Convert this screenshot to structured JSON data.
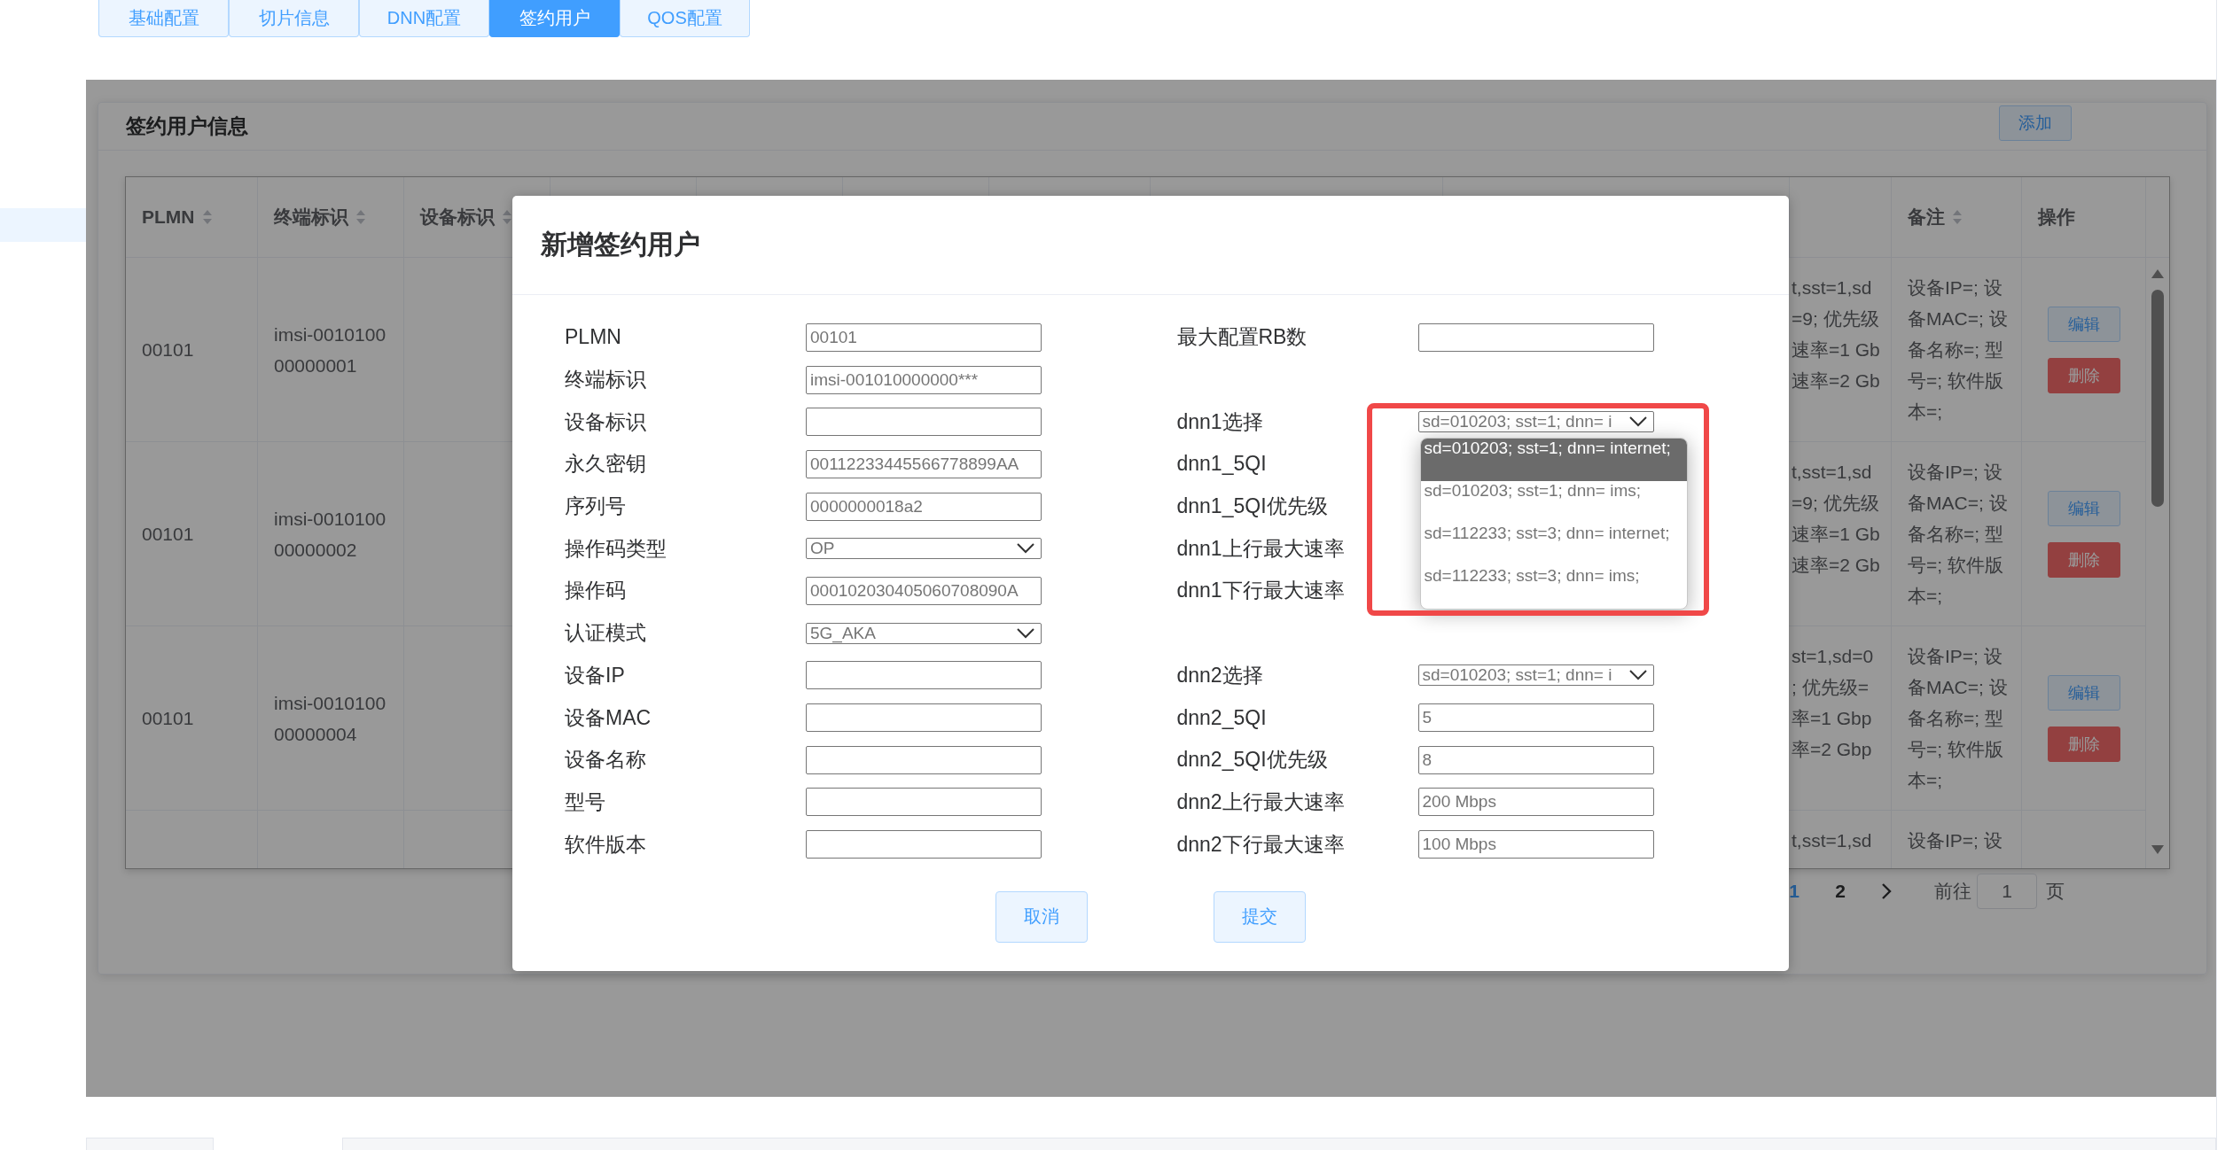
{
  "tabs": [
    {
      "label": "基础配置",
      "selected": false
    },
    {
      "label": "切片信息",
      "selected": false
    },
    {
      "label": "DNN配置",
      "selected": false
    },
    {
      "label": "签约用户",
      "selected": true
    },
    {
      "label": "QOS配置",
      "selected": false
    }
  ],
  "panel": {
    "title": "签约用户信息",
    "add_button": "添加"
  },
  "table": {
    "columns": [
      {
        "label": "PLMN",
        "sortable": true
      },
      {
        "label": "终端标识",
        "sortable": true
      },
      {
        "label": "设备标识",
        "sortable": true
      },
      {
        "label": "备注",
        "sortable": true
      },
      {
        "label": "操作",
        "sortable": false
      }
    ],
    "rows": [
      {
        "plmn": "00101",
        "imsi": [
          "imsi-0010100",
          "00000001"
        ],
        "column_4": [
          "t,sst=1,sd",
          "=9; 优先级",
          "速率=1 Gb",
          "速率=2 Gb"
        ],
        "remark": [
          "设备IP=; 设",
          "备MAC=; 设",
          "备名称=; 型",
          "号=; 软件版",
          "本=;"
        ],
        "actions": [
          {
            "label": "编辑",
            "kind": "edit"
          },
          {
            "label": "删除",
            "kind": "delete"
          }
        ]
      },
      {
        "plmn": "00101",
        "imsi": [
          "imsi-0010100",
          "00000002"
        ],
        "column_4": [
          "t,sst=1,sd",
          "=9; 优先级",
          "速率=1 Gb",
          "速率=2 Gb"
        ],
        "remark": [
          "设备IP=; 设",
          "备MAC=; 设",
          "备名称=; 型",
          "号=; 软件版",
          "本=;"
        ],
        "actions": [
          {
            "label": "编辑",
            "kind": "edit"
          },
          {
            "label": "删除",
            "kind": "delete"
          }
        ]
      },
      {
        "plmn": "00101",
        "imsi": [
          "imsi-0010100",
          "00000004"
        ],
        "column_4": [
          "st=1,sd=0",
          "; 优先级=",
          "率=1 Gbp",
          "率=2 Gbp"
        ],
        "remark": [
          "设备IP=; 设",
          "备MAC=; 设",
          "备名称=; 型",
          "号=; 软件版",
          "本=;"
        ],
        "actions": [
          {
            "label": "编辑",
            "kind": "edit"
          },
          {
            "label": "删除",
            "kind": "delete"
          }
        ]
      },
      {
        "column_4": [
          "t,sst=1,sd"
        ],
        "remark": [
          "设备IP=; 设"
        ]
      }
    ]
  },
  "pagination": {
    "pages": [
      {
        "label": "1",
        "selected": true
      },
      {
        "label": "2",
        "selected": false
      }
    ],
    "goto_label": "前往",
    "page_input": "1",
    "page_suffix": "页"
  },
  "modal": {
    "title": "新增签约用户",
    "left_fields": [
      {
        "label": "PLMN",
        "kind": "input",
        "placeholder": "00101"
      },
      {
        "label": "终端标识",
        "kind": "input",
        "placeholder": "imsi-001010000000***"
      },
      {
        "label": "设备标识",
        "kind": "input"
      },
      {
        "label": "永久密钥",
        "kind": "input",
        "placeholder": "00112233445566778899AA"
      },
      {
        "label": "序列号",
        "kind": "input",
        "placeholder": "0000000018a2"
      },
      {
        "label": "操作码类型",
        "kind": "select",
        "value": "OP"
      },
      {
        "label": "操作码",
        "kind": "input",
        "placeholder": "000102030405060708090A"
      },
      {
        "label": "认证模式",
        "kind": "select",
        "value": "5G_AKA"
      },
      {
        "label": "设备IP",
        "kind": "input"
      },
      {
        "label": "设备MAC",
        "kind": "input"
      },
      {
        "label": "设备名称",
        "kind": "input"
      },
      {
        "label": "型号",
        "kind": "input"
      },
      {
        "label": "软件版本",
        "kind": "input"
      }
    ],
    "right_groups": [
      [
        {
          "label": "最大配置RB数",
          "kind": "input"
        }
      ],
      [
        {
          "label": "dnn1选择",
          "kind": "select",
          "value": "sd=010203; sst=1; dnn= i",
          "open": true,
          "highlighted": true,
          "options": [
            {
              "label": "sd=010203; sst=1; dnn= internet;",
              "selected": true
            },
            {
              "label": "sd=010203; sst=1; dnn= ims;",
              "selected": false
            },
            {
              "label": "sd=112233; sst=3; dnn= internet;",
              "selected": false
            },
            {
              "label": "sd=112233; sst=3; dnn= ims;",
              "selected": false
            }
          ]
        },
        {
          "label": "dnn1_5QI",
          "kind": "label"
        },
        {
          "label": "dnn1_5QI优先级",
          "kind": "label"
        },
        {
          "label": "dnn1上行最大速率",
          "kind": "label"
        },
        {
          "label": "dnn1下行最大速率",
          "kind": "label"
        }
      ],
      [
        {
          "label": "dnn2选择",
          "kind": "select",
          "value": "sd=010203; sst=1; dnn= i"
        },
        {
          "label": "dnn2_5QI",
          "kind": "input",
          "placeholder": "5"
        },
        {
          "label": "dnn2_5QI优先级",
          "kind": "input",
          "placeholder": "8"
        },
        {
          "label": "dnn2上行最大速率",
          "kind": "input",
          "placeholder": "200 Mbps"
        },
        {
          "label": "dnn2下行最大速率",
          "kind": "input",
          "placeholder": "100 Mbps"
        }
      ]
    ],
    "buttons": [
      "取消",
      "提交"
    ]
  }
}
